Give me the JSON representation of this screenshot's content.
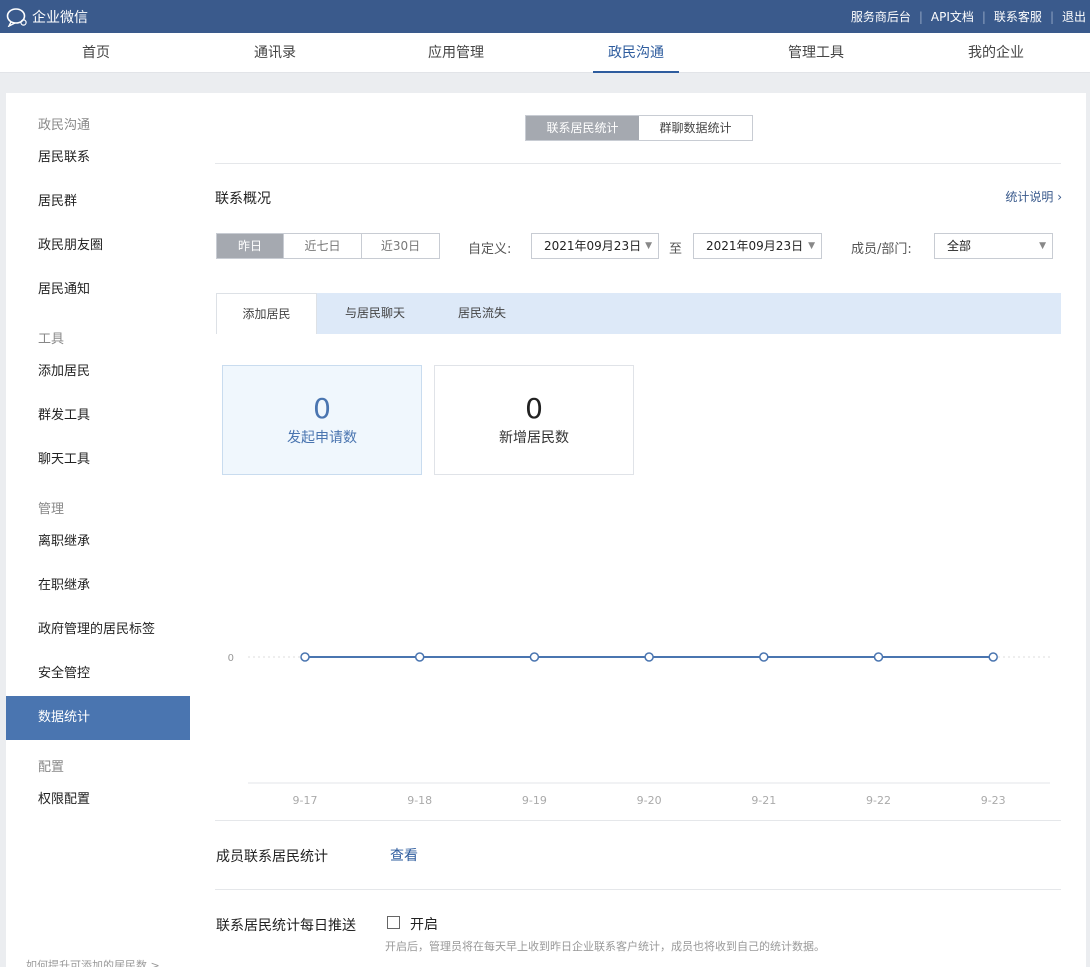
{
  "app": {
    "name": "企业微信",
    "top_links": [
      "服务商后台",
      "API文档",
      "联系客服",
      "退出"
    ]
  },
  "nav": {
    "items": [
      "首页",
      "通讯录",
      "应用管理",
      "政民沟通",
      "管理工具",
      "我的企业"
    ],
    "active": "政民沟通"
  },
  "sidebar": {
    "groups": [
      {
        "title": "政民沟通",
        "items": [
          "居民联系",
          "居民群",
          "政民朋友圈",
          "居民通知"
        ]
      },
      {
        "title": "工具",
        "items": [
          "添加居民",
          "群发工具",
          "聊天工具"
        ]
      },
      {
        "title": "管理",
        "items": [
          "离职继承",
          "在职继承",
          "政府管理的居民标签",
          "安全管控",
          "数据统计"
        ]
      },
      {
        "title": "配置",
        "items": [
          "权限配置"
        ]
      }
    ],
    "active": "数据统计",
    "footer": "如何提升可添加的居民数 >"
  },
  "main": {
    "view_switch": [
      "联系居民统计",
      "群聊数据统计"
    ],
    "view_active": "联系居民统计",
    "section_title": "联系概况",
    "help_link": "统计说明",
    "range_tabs": [
      "昨日",
      "近七日",
      "近30日"
    ],
    "range_active": "昨日",
    "custom_label": "自定义:",
    "date_from": "2021年09月23日",
    "to_label": "至",
    "date_to": "2021年09月23日",
    "member_label": "成员/部门:",
    "member_value": "全部",
    "metric_tabs": [
      "添加居民",
      "与居民聊天",
      "居民流失"
    ],
    "metric_active": "添加居民",
    "cards": [
      {
        "value": "0",
        "label": "发起申请数"
      },
      {
        "value": "0",
        "label": "新增居民数"
      }
    ],
    "member_stats_label": "成员联系居民统计",
    "view_link": "查看",
    "push_label": "联系居民统计每日推送",
    "enable_label": "开启",
    "push_note": "开启后，管理员将在每天早上收到昨日企业联系客户统计，成员也将收到自己的统计数据。"
  },
  "chart_data": {
    "type": "line",
    "categories": [
      "9-17",
      "9-18",
      "9-19",
      "9-20",
      "9-21",
      "9-22",
      "9-23"
    ],
    "values": [
      0,
      0,
      0,
      0,
      0,
      0,
      0
    ],
    "yticks": [
      "0"
    ],
    "title": "",
    "xlabel": "",
    "ylabel": "",
    "line_color": "#4a75b0",
    "grid": true
  },
  "colors": {
    "topbar": "#3a5a8c",
    "accent": "#2e5c9e",
    "sidebar_active": "#4a75b0",
    "tab_bg": "#dde9f8"
  }
}
